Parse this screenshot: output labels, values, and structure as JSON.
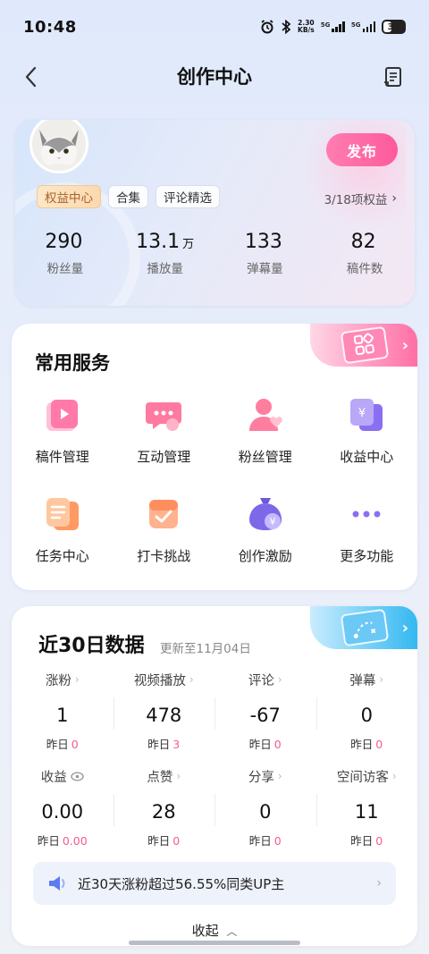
{
  "status_bar": {
    "time": "10:48",
    "speed_value": "2.30",
    "speed_unit": "KB/s",
    "net1": "5G",
    "net2": "5G",
    "battery": "38"
  },
  "header": {
    "title": "创作中心"
  },
  "profile": {
    "publish_label": "发布",
    "tags": [
      "权益中心",
      "合集",
      "评论精选"
    ],
    "rights_text": "3/18项权益",
    "stats": [
      {
        "value": "290",
        "unit": "",
        "label": "粉丝量"
      },
      {
        "value": "13.1",
        "unit": "万",
        "label": "播放量"
      },
      {
        "value": "133",
        "unit": "",
        "label": "弹幕量"
      },
      {
        "value": "82",
        "unit": "",
        "label": "稿件数"
      }
    ]
  },
  "services": {
    "title": "常用服务",
    "items": [
      {
        "label": "稿件管理",
        "icon": "manuscript-icon"
      },
      {
        "label": "互动管理",
        "icon": "chat-bubble-icon"
      },
      {
        "label": "粉丝管理",
        "icon": "fan-user-icon"
      },
      {
        "label": "收益中心",
        "icon": "yen-cards-icon"
      },
      {
        "label": "任务中心",
        "icon": "clipboard-icon"
      },
      {
        "label": "打卡挑战",
        "icon": "checkin-icon"
      },
      {
        "label": "创作激励",
        "icon": "money-bag-icon"
      },
      {
        "label": "更多功能",
        "icon": "more-dots-icon"
      }
    ]
  },
  "data_panel": {
    "title": "近30日数据",
    "updated": "更新至11月04日",
    "prev_label": "昨日",
    "rows": [
      [
        {
          "label": "涨粉",
          "value": "1",
          "prev": "0"
        },
        {
          "label": "视频播放",
          "value": "478",
          "prev": "3"
        },
        {
          "label": "评论",
          "value": "-67",
          "prev": "0"
        },
        {
          "label": "弹幕",
          "value": "0",
          "prev": "0"
        }
      ],
      [
        {
          "label": "收益",
          "value": "0.00",
          "prev": "0.00"
        },
        {
          "label": "点赞",
          "value": "28",
          "prev": "0"
        },
        {
          "label": "分享",
          "value": "0",
          "prev": "0"
        },
        {
          "label": "空间访客",
          "value": "11",
          "prev": "0"
        }
      ]
    ],
    "tip": "近30天涨粉超过56.55%同类UP主",
    "collapse": "收起"
  },
  "colors": {
    "accent_pink": "#fe5a9c",
    "accent_blue": "#34b8f0",
    "prev_value": "#f25d8e"
  }
}
